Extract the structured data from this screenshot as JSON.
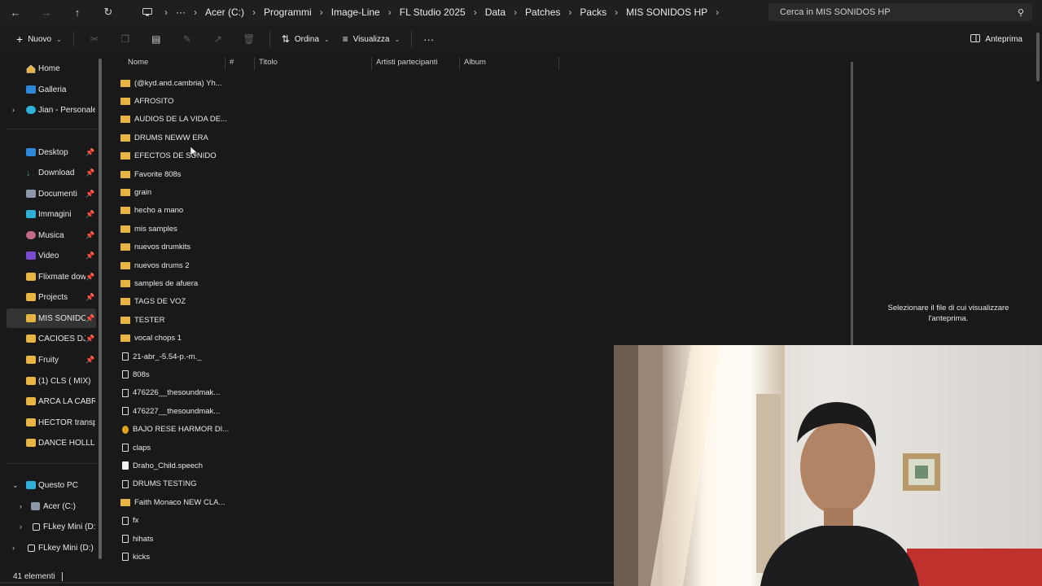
{
  "nav": {
    "back_icon": "back-arrow-icon",
    "forward_icon": "forward-arrow-icon",
    "up_icon": "up-arrow-icon",
    "refresh_icon": "refresh-icon"
  },
  "breadcrumb": [
    "Acer (C:)",
    "Programmi",
    "Image-Line",
    "FL Studio 2025",
    "Data",
    "Patches",
    "Packs",
    "MIS SONIDOS HP"
  ],
  "search": {
    "placeholder": "Cerca in MIS SONIDOS HP"
  },
  "commandbar": {
    "new_label": "Nuovo",
    "sort_label": "Ordina",
    "view_label": "Visualizza",
    "more_label": "···",
    "preview_label": "Anteprima"
  },
  "sidebar": {
    "top": [
      {
        "label": "Home"
      },
      {
        "label": "Galleria"
      },
      {
        "label": "Jian - Personale"
      }
    ],
    "quick": [
      {
        "label": "Desktop"
      },
      {
        "label": "Download"
      },
      {
        "label": "Documenti"
      },
      {
        "label": "Immagini"
      },
      {
        "label": "Musica"
      },
      {
        "label": "Video"
      },
      {
        "label": "Flixmate dow"
      },
      {
        "label": "Projects"
      },
      {
        "label": "MIS SONIDOS"
      },
      {
        "label": "CACIOES DJ"
      },
      {
        "label": "Fruity"
      },
      {
        "label": "(1) CLS ( MIX)"
      },
      {
        "label": "ARCA LA CABRA"
      },
      {
        "label": "HECTOR transpla"
      },
      {
        "label": "DANCE HOLLL"
      }
    ],
    "pc": [
      {
        "label": "Questo PC"
      },
      {
        "label": "Acer (C:)"
      },
      {
        "label": "FLkey Mini (D:)"
      },
      {
        "label": "FLkey Mini (D:)"
      }
    ]
  },
  "columns": [
    "Nome",
    "#",
    "Titolo",
    "Artisti partecipanti",
    "Album"
  ],
  "files": [
    {
      "name": "(@kyd.and.cambria) Yh...",
      "type": "folder"
    },
    {
      "name": "AFROSITO",
      "type": "folder"
    },
    {
      "name": "AUDIOS DE LA VIDA DE...",
      "type": "folder"
    },
    {
      "name": "DRUMS NEWW ERA",
      "type": "folder"
    },
    {
      "name": "EFECTOS DE SONIDO",
      "type": "folder"
    },
    {
      "name": "Favorite 808s",
      "type": "folder"
    },
    {
      "name": "grain",
      "type": "folder"
    },
    {
      "name": "hecho a mano",
      "type": "folder"
    },
    {
      "name": "mis samples",
      "type": "folder"
    },
    {
      "name": "nuevos drumkits",
      "type": "folder"
    },
    {
      "name": "nuevos drums 2",
      "type": "folder"
    },
    {
      "name": "samples de afuera",
      "type": "folder"
    },
    {
      "name": "TAGS DE VOZ",
      "type": "folder"
    },
    {
      "name": "TESTER",
      "type": "folder"
    },
    {
      "name": "vocal chops 1",
      "type": "folder"
    },
    {
      "name": "21-abr_-5.54-p.-m._",
      "type": "file"
    },
    {
      "name": "808s",
      "type": "file"
    },
    {
      "name": "476226__thesoundmak...",
      "type": "file"
    },
    {
      "name": "476227__thesoundmak...",
      "type": "file"
    },
    {
      "name": "BAJO RESE HARMOR DI...",
      "type": "fl"
    },
    {
      "name": "claps",
      "type": "file"
    },
    {
      "name": "Draho_Child.speech",
      "type": "doc"
    },
    {
      "name": "DRUMS TESTING",
      "type": "file"
    },
    {
      "name": "Faith Monaco NEW CLA...",
      "type": "folder"
    },
    {
      "name": "fx",
      "type": "file"
    },
    {
      "name": "hihats",
      "type": "file"
    },
    {
      "name": "kicks",
      "type": "file"
    }
  ],
  "preview": {
    "message": "Selezionare il file di cui visualizzare l'anteprima."
  },
  "status": {
    "count": "41 elementi"
  },
  "colors": {
    "folder": "#e8b545",
    "bg": "#191919",
    "accent": "#2e87d8"
  }
}
